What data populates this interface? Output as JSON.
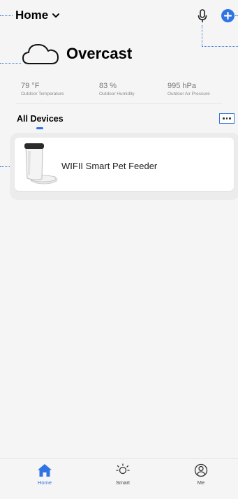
{
  "header": {
    "home_title": "Home",
    "mic_icon": "microphone-icon",
    "add_icon": "plus-circle-icon"
  },
  "weather": {
    "icon": "cloud-icon",
    "condition": "Overcast"
  },
  "stats": [
    {
      "value": "79 °F",
      "label": "Outdoor Temperature"
    },
    {
      "value": "83 %",
      "label": "Outdoor Humidity"
    },
    {
      "value": "995 hPa",
      "label": "Outdoor Air Pressure"
    }
  ],
  "devices": {
    "tab_label": "All Devices",
    "items": [
      {
        "name": "WIFII  Smart Pet Feeder",
        "icon": "pet-feeder-image"
      }
    ]
  },
  "tabbar": {
    "items": [
      {
        "label": "Home",
        "icon": "home-icon",
        "active": true
      },
      {
        "label": "Smart",
        "icon": "sun-icon",
        "active": false
      },
      {
        "label": "Me",
        "icon": "user-icon",
        "active": false
      }
    ]
  },
  "colors": {
    "accent": "#2f73e4",
    "background": "#f5f5f5",
    "card": "#ffffff"
  }
}
